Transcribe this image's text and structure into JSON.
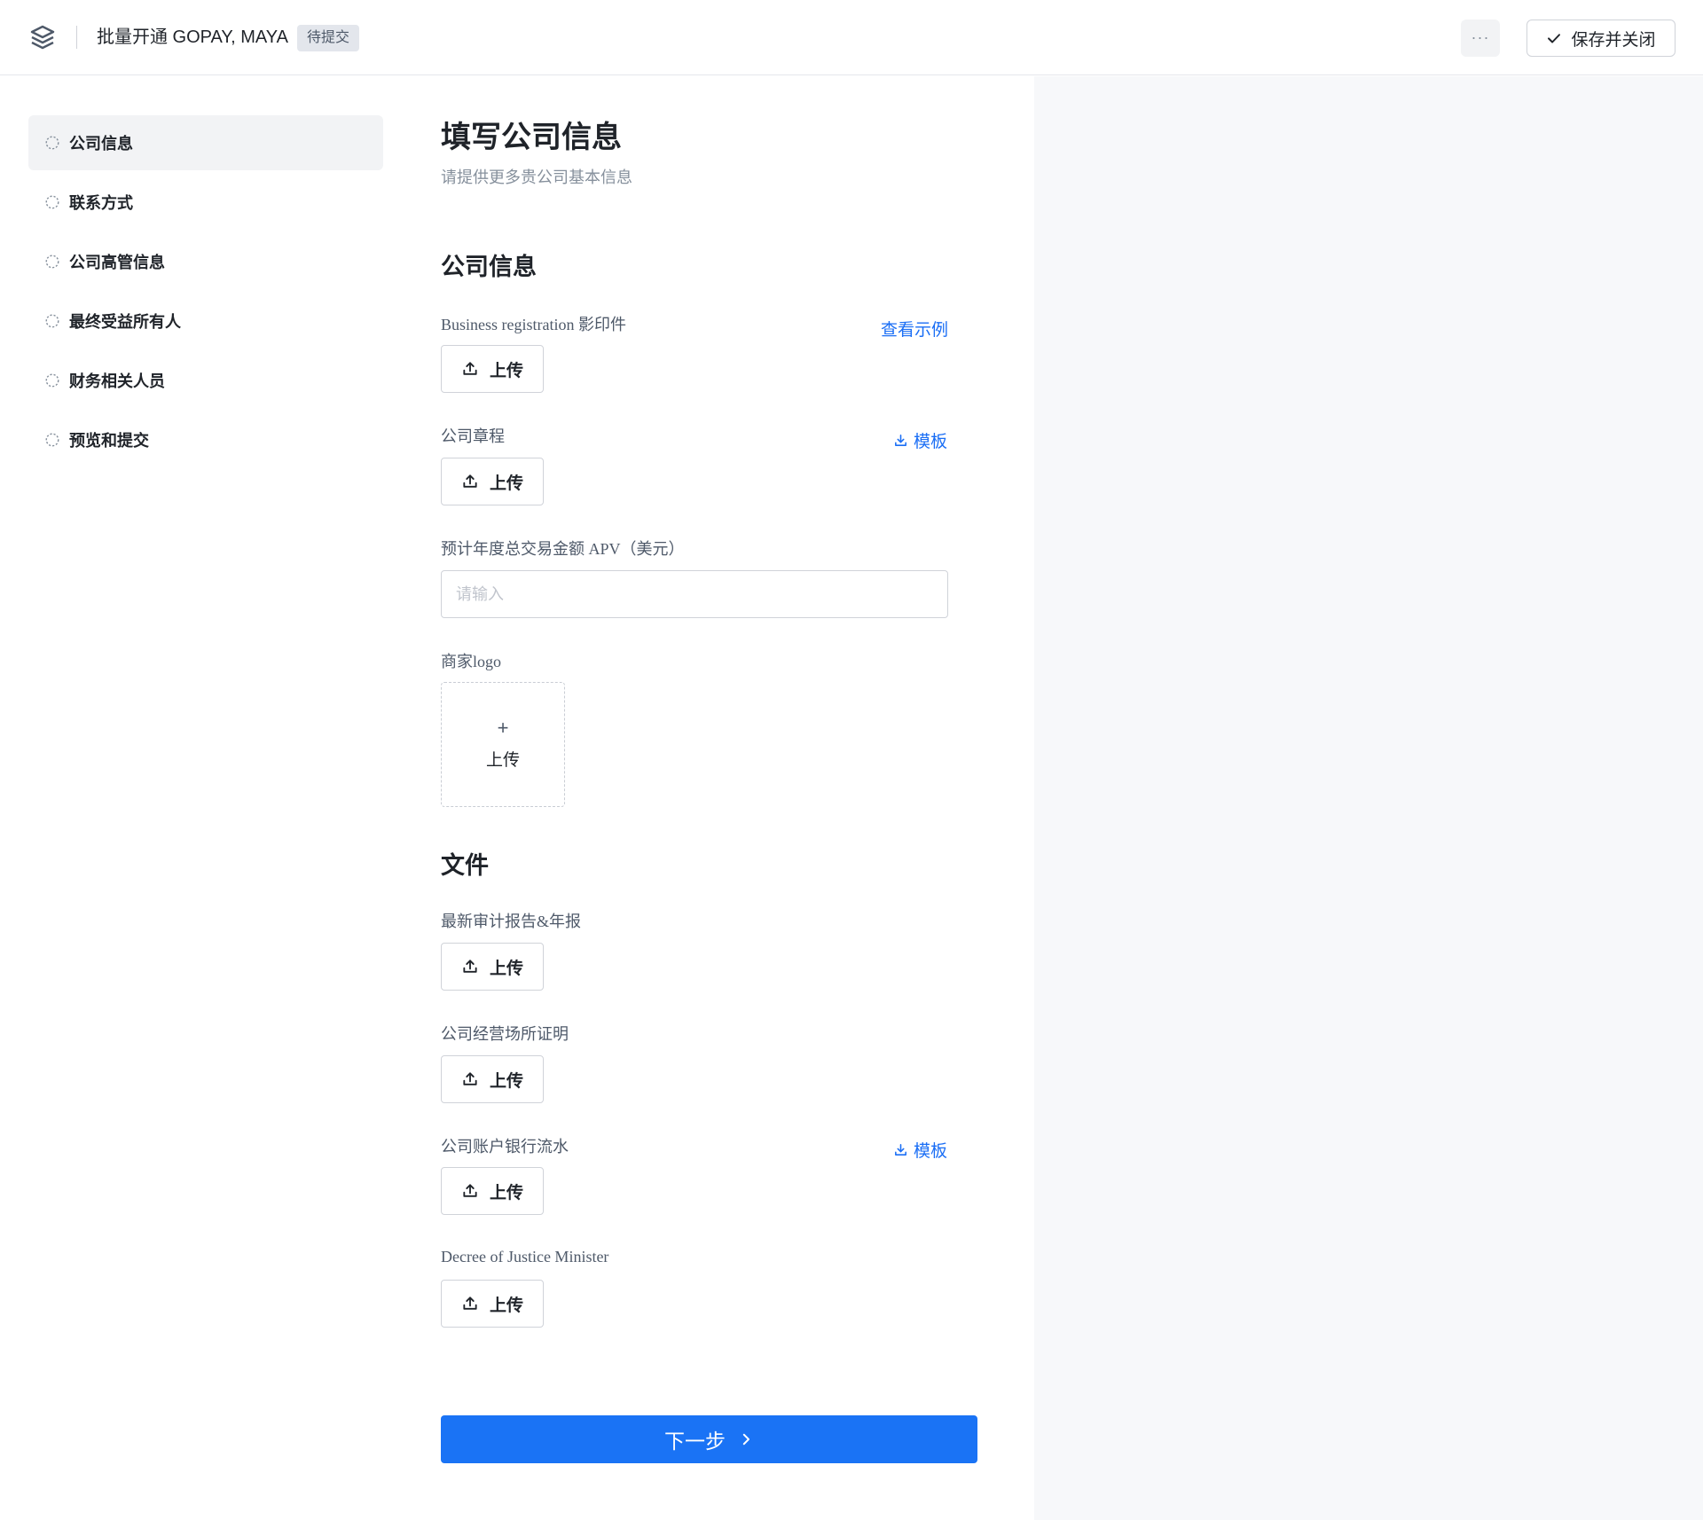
{
  "header": {
    "title": "批量开通 GOPAY, MAYA",
    "status": "待提交",
    "more": "···",
    "save_label": "保存并关闭"
  },
  "nav": {
    "items": [
      {
        "label": "公司信息",
        "active": true
      },
      {
        "label": "联系方式"
      },
      {
        "label": "公司高管信息"
      },
      {
        "label": "最终受益所有人"
      },
      {
        "label": "财务相关人员"
      },
      {
        "label": "预览和提交"
      }
    ]
  },
  "form": {
    "title": "填写公司信息",
    "subtitle": "请提供更多贵公司基本信息",
    "section_company": "公司信息",
    "business_reg": {
      "label": "Business registration 影印件",
      "link": "查看示例"
    },
    "articles": {
      "label": "公司章程",
      "link": "模板"
    },
    "apv": {
      "label": "预计年度总交易金额 APV（美元）",
      "placeholder": "请输入",
      "value": ""
    },
    "merchant_logo": {
      "label": "商家logo",
      "upload": "上传",
      "plus": "+"
    },
    "section_files": "文件",
    "audit": {
      "label": "最新审计报告&年报"
    },
    "premises": {
      "label": "公司经营场所证明"
    },
    "bank": {
      "label": "公司账户银行流水",
      "link": "模板"
    },
    "decree": {
      "label": "Decree of Justice Minister"
    },
    "upload_label": "上传",
    "next_label": "下一步"
  }
}
